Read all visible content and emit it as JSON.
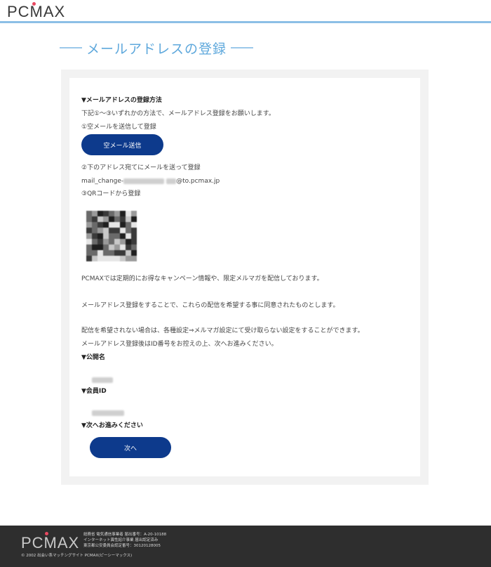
{
  "header": {
    "logo": "PCMAX",
    "brand_line_color": "#8cbfe6"
  },
  "page": {
    "title": "メールアドレスの登録"
  },
  "main": {
    "method_heading": "▼メールアドレスの登録方法",
    "method_intro": "下記①〜③いずれかの方法で、メールアドレス登録をお願いします。",
    "option1_label": "①空メールを送信して登録",
    "option1_button": "空メール送信",
    "option2_label": "②下のアドレス宛てにメールを送って登録",
    "option2_address_prefix": "mail_change-",
    "option2_address_suffix": "@to.pcmax.jp",
    "option3_label": "③QRコードから登録",
    "info_text_1": "PCMAXでは定期的にお得なキャンペーン情報や、限定メルマガを配信しております。",
    "info_text_2": "メールアドレス登録をすることで、これらの配信を希望する事に同意されたものとします。",
    "info_text_3": "配信を希望されない場合は、各種設定⇒メルマガ設定にて受け取らない設定をすることができます。",
    "info_text_4": "メールアドレス登録後はID番号をお控えの上、次へお進みください。",
    "public_name_heading": "▼公開名",
    "member_id_heading": "▼会員ID",
    "next_heading": "▼次へお進みください",
    "next_button": "次へ"
  },
  "footer": {
    "logo": "PCMAX",
    "license_1": "総務省 電気通信事業者 届出番号：A-20-10188",
    "license_2": "インターネット異性紹介事業 届出認定済み",
    "license_3": "東京都公安委員会認定番号：30120128005",
    "copyright": "© 2002 出会い系マッチングサイト PCMAX(ピーシーマックス)"
  },
  "colors": {
    "accent_blue": "#5ea8dc",
    "button_navy": "#0d3a8c",
    "footer_bg": "#2e2e2e",
    "logo_dot": "#e84860"
  }
}
